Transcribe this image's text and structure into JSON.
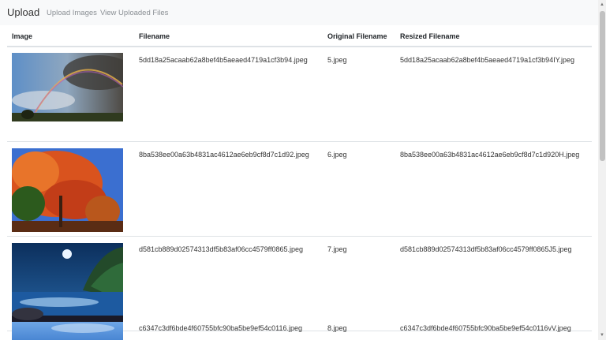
{
  "navbar": {
    "brand": "Upload",
    "links": [
      "Upload Images",
      "View Uploaded Files"
    ]
  },
  "table": {
    "headers": {
      "image": "Image",
      "filename": "Filename",
      "original": "Original Filename",
      "resized": "Resized Filename"
    },
    "rows": [
      {
        "filename": "5dd18a25acaab62a8bef4b5aeaed4719a1cf3b94.jpeg",
        "original": "5.jpeg",
        "resized": "5dd18a25acaab62a8bef4b5aeaed4719a1cf3b94IY.jpeg",
        "image": "rainbow-landscape"
      },
      {
        "filename": "8ba538ee00a63b4831ac4612ae6eb9cf8d7c1d92.jpeg",
        "original": "6.jpeg",
        "resized": "8ba538ee00a63b4831ac4612ae6eb9cf8d7c1d920H.jpeg",
        "image": "autumn-tree"
      },
      {
        "filename": "d581cb889d02574313df5b83af06cc4579ff0865.jpeg",
        "original": "7.jpeg",
        "resized": "d581cb889d02574313df5b83af06cc4579ff0865J5.jpeg",
        "image": "night-beach"
      },
      {
        "filename": "c6347c3df6bde4f60755bfc90ba5be9ef54c0116.jpeg",
        "original": "8.jpeg",
        "resized": "c6347c3df6bde4f60755bfc90ba5be9ef54c0116vV.jpeg",
        "image": "sky"
      }
    ]
  }
}
